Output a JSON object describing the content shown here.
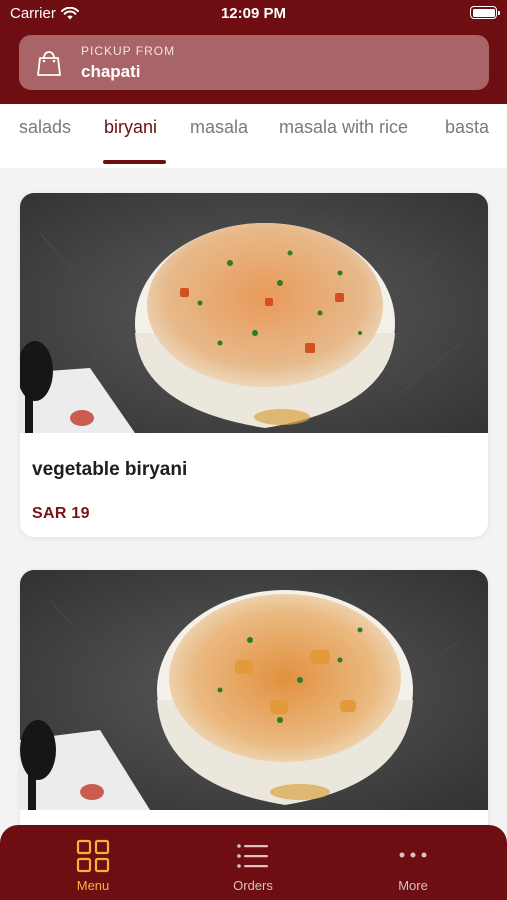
{
  "status_bar": {
    "carrier": "Carrier",
    "time": "12:09 PM"
  },
  "pickup": {
    "label": "PICKUP FROM",
    "value": "chapati"
  },
  "tabs": [
    {
      "label": "salads",
      "active": false
    },
    {
      "label": "biryani",
      "active": true
    },
    {
      "label": "masala",
      "active": false
    },
    {
      "label": "masala with rice",
      "active": false
    },
    {
      "label": "basta",
      "active": false
    }
  ],
  "items": [
    {
      "name": "vegetable biryani",
      "price": "SAR 19"
    },
    {
      "name": "",
      "price": ""
    }
  ],
  "nav": [
    {
      "label": "Menu",
      "icon": "grid-icon",
      "active": true
    },
    {
      "label": "Orders",
      "icon": "list-icon",
      "active": false
    },
    {
      "label": "More",
      "icon": "more-dots-icon",
      "active": false
    }
  ],
  "colors": {
    "brand": "#6e0e12",
    "accent": "#f2b33a",
    "price": "#7a1418"
  }
}
